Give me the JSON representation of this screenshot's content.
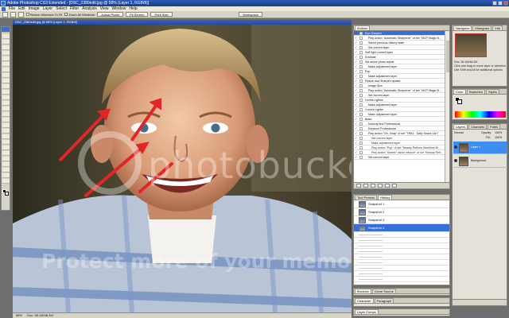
{
  "window": {
    "title": "Adobe Photoshop CS3 Extended - [DSC_2380edit.jpg @ 58% (Layer 1, RGB/8)]"
  },
  "menu": [
    "File",
    "Edit",
    "Image",
    "Layer",
    "Select",
    "Filter",
    "Analysis",
    "View",
    "Window",
    "Help"
  ],
  "options_bar": {
    "resize_windows_label": "Resize Windows To Fit",
    "zoom_all_label": "Zoom All Windows",
    "actual_pixels_label": "Actual Pixels",
    "fit_screen_label": "Fit Screen",
    "print_size_label": "Print Size",
    "workspace_label": "Workspace"
  },
  "document": {
    "title": "DSC_2380edit.jpg @ 58% (Layer 1, RGB/8)",
    "zoom": "58%",
    "doc_size": "Doc: 38.1M/48.2M"
  },
  "watermark": {
    "brand": "photobucket",
    "tagline": "Protect more of your memories for less!"
  },
  "actions_panel": {
    "tabs": [
      "Actions",
      "x"
    ],
    "rows": [
      {
        "label": "Eye Sharpen",
        "level": 0,
        "checked": true,
        "selected": true
      },
      {
        "label": "Play action \"Automatic Sharpener\" of set \"MCP Magic B...",
        "level": 1,
        "checked": true
      },
      {
        "label": "Select previous history state",
        "level": 1,
        "checked": true
      },
      {
        "label": "Set current layer",
        "level": 1,
        "checked": true
      },
      {
        "label": "Soft light current layer",
        "level": 0,
        "checked": true
      },
      {
        "label": "Exfoliate",
        "level": 0,
        "checked": true
      },
      {
        "label": "Set active photo adjust",
        "level": 0,
        "checked": true
      },
      {
        "label": "Make adjustment layer",
        "level": 1,
        "checked": true
      },
      {
        "label": "Pop",
        "level": 0,
        "checked": true
      },
      {
        "label": "Make adjustment layer",
        "level": 1,
        "checked": true
      },
      {
        "label": "Resize and Sharpen update",
        "level": 0,
        "checked": true
      },
      {
        "label": "Image Size",
        "level": 1,
        "checked": true
      },
      {
        "label": "Play action \"Automatic Sharpener\" of set \"MCP Magic B...",
        "level": 1,
        "checked": true
      },
      {
        "label": "Set current layer",
        "level": 1,
        "checked": true
      },
      {
        "label": "Levels Lighten",
        "level": 0,
        "checked": true
      },
      {
        "label": "Make adjustment layer",
        "level": 1,
        "checked": true
      },
      {
        "label": "Curves Lighter",
        "level": 0,
        "checked": true
      },
      {
        "label": "Make adjustment layer",
        "level": 1,
        "checked": true
      },
      {
        "label": "Basic",
        "level": 0,
        "checked": true
      },
      {
        "label": "Nobody and Professional",
        "level": 1,
        "checked": true
      },
      {
        "label": "Enhance Professional",
        "level": 1,
        "checked": true
      },
      {
        "label": "Play action \"Oh, Snap\" of set \"TRA1 - Daily Snack Lis?\"",
        "level": 1,
        "checked": true
      },
      {
        "label": "Set current layer",
        "level": 2,
        "checked": true
      },
      {
        "label": "Make adjustment layer",
        "level": 2,
        "checked": true
      },
      {
        "label": "Play action \"Pop\" of set \"Beauty Refines Workflow Bi...",
        "level": 2,
        "checked": true
      },
      {
        "label": "Play action \"Sweet? vision retouch\" of set \"Beauty Refi...",
        "level": 2,
        "checked": true
      },
      {
        "label": "Set current layer",
        "level": 1,
        "checked": true
      }
    ]
  },
  "history_panel": {
    "tabs": [
      "Tool Presets",
      "History"
    ],
    "snapshots": [
      {
        "label": "Snapshot 1"
      },
      {
        "label": "Snapshot 2"
      },
      {
        "label": "Snapshot 3"
      },
      {
        "label": "Snapshot 4",
        "selected": true
      }
    ]
  },
  "brushes_panel": {
    "tabs": [
      "Brushes",
      "Clone Source"
    ]
  },
  "layer_comps_panel": {
    "tabs": [
      "Character",
      "Paragraph"
    ]
  },
  "layer_comps2_panel": {
    "tabs": [
      "Layer Comps"
    ]
  },
  "navigator_panel": {
    "tabs": [
      "Navigator",
      "Histogram",
      "Info"
    ],
    "doc_line": "Doc: 38.1M/48.2M",
    "hint": "Click and drag to move layer or selection. Use Shift and Alt for additional options."
  },
  "color_panel": {
    "tabs": [
      "Color",
      "Swatches",
      "Styles"
    ]
  },
  "layers_panel": {
    "tabs": [
      "Layers",
      "Channels",
      "Paths"
    ],
    "blend_mode": "Normal",
    "opacity_label": "Opacity:",
    "opacity_value": "100%",
    "fill_label": "Fill:",
    "fill_value": "100%",
    "layers": [
      {
        "name": "Layer 1",
        "selected": true
      },
      {
        "name": "Background",
        "selected": false
      }
    ]
  }
}
